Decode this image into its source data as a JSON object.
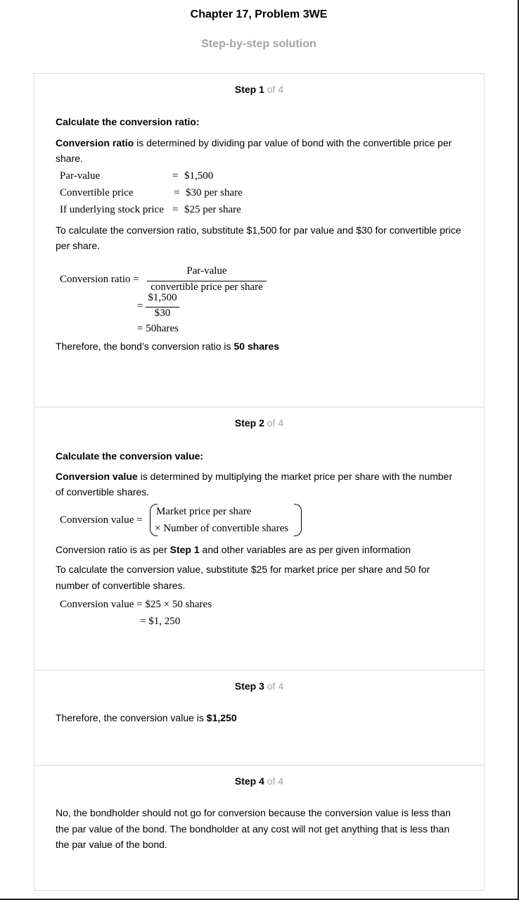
{
  "header": {
    "title": "Chapter 17, Problem 3WE",
    "subtitle": "Step-by-step solution"
  },
  "steps": [
    {
      "label": "Step 1",
      "of": "of 4",
      "heading": "Calculate the conversion ratio:",
      "def_term": "Conversion ratio",
      "def_rest": " is determined by dividing par value of bond with the convertible price per share.",
      "givens": [
        {
          "label": "Par-value",
          "eq": "=",
          "value": "$1,500"
        },
        {
          "label": "Convertible price",
          "eq": "=",
          "value": "$30 per share"
        },
        {
          "label": "If underlying stock price",
          "eq": "=",
          "value": "$25 per share"
        }
      ],
      "instruction": "To calculate the conversion ratio, substitute $1,500 for par value and $30 for convertible price per share.",
      "formula": {
        "lhs": "Conversion ratio =",
        "num": "Par-value",
        "den": "convertible price per share",
        "eq2": "=",
        "num2": "$1,500",
        "den2": "$30",
        "result": "= 50hares"
      },
      "conclusion_pre": "Therefore, the bond’s conversion ratio is ",
      "conclusion_bold": "50 shares"
    },
    {
      "label": "Step 2",
      "of": "of 4",
      "heading": "Calculate the conversion value:",
      "def_term": "Conversion value",
      "def_rest": " is determined by multiplying the market price per share with the number of convertible shares.",
      "formula": {
        "lhs": "Conversion value =",
        "line1": "Market price per share",
        "line2": "× Number of convertible shares"
      },
      "note_pre": "Conversion ratio is as per ",
      "note_bold": "Step 1",
      "note_post": " and other variables are as per given information",
      "instruction": "To calculate the conversion value, substitute $25 for market price per share and 50 for number of convertible shares.",
      "calc1": "Conversion value = $25 × 50 shares",
      "calc2": "= $1, 250"
    },
    {
      "label": "Step 3",
      "of": "of 4",
      "text_pre": "Therefore, the conversion value is ",
      "text_bold": "$1,250"
    },
    {
      "label": "Step 4",
      "of": "of 4",
      "text": "No, the bondholder should not go for conversion because the conversion value is less than the par value of the bond. The bondholder at any cost will not get anything that is less than the par value of the bond."
    }
  ]
}
